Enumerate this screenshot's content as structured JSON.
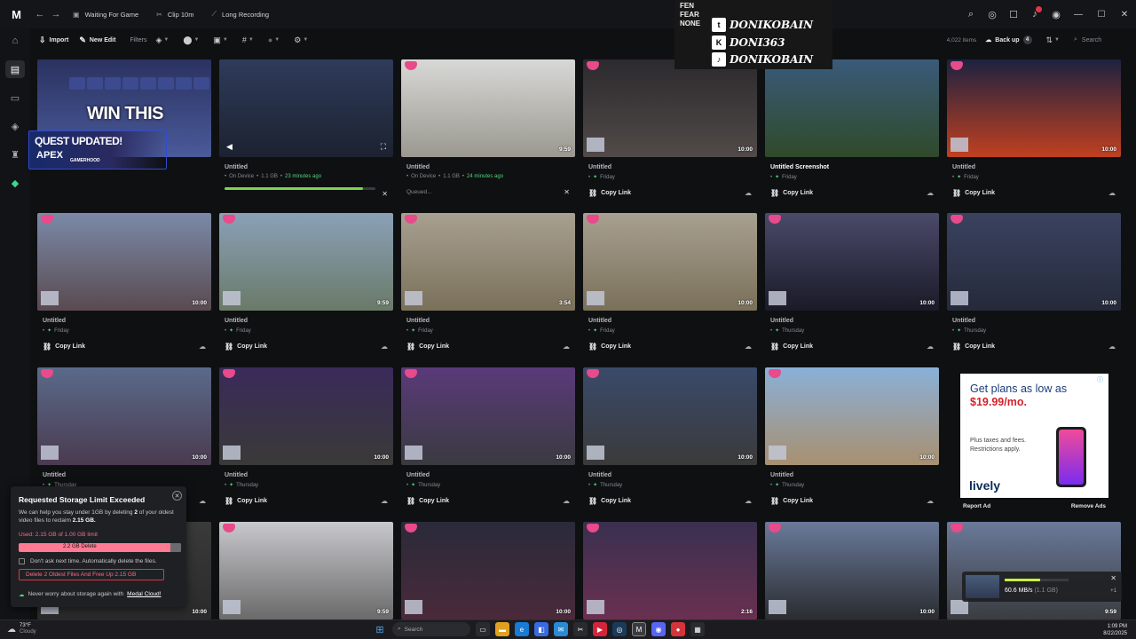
{
  "window": {
    "logo": "M",
    "tabs": [
      {
        "label": "Waiting For Game",
        "icon": "gamepad-icon"
      },
      {
        "label": "Clip 10m",
        "icon": "scissors-icon"
      },
      {
        "label": "Long Recording",
        "icon": "slash-icon"
      }
    ]
  },
  "toolbar": {
    "import_label": "Import",
    "new_edit_label": "New Edit",
    "filters_label": "Filters",
    "items_count": "4,022 items",
    "backup_label": "Back up",
    "backup_count": "4",
    "search_placeholder": "Search"
  },
  "promo": {
    "headline": "WIN THIS",
    "quest_title": "QUEST UPDATED!",
    "quest_game": "APEX",
    "quest_sponsor": "GAMERHOOD"
  },
  "socials": {
    "tag": "FEN FEAR NONE",
    "rows": [
      {
        "network": "twitch",
        "glyph": "t",
        "name": "DONIKOBAIN"
      },
      {
        "network": "kick",
        "glyph": "K",
        "name": "DONI363"
      },
      {
        "network": "tiktok",
        "glyph": "♪",
        "name": "DONIKOBAIN"
      }
    ]
  },
  "cards": [
    {
      "title": "",
      "kind": "promo"
    },
    {
      "title": "Untitled",
      "meta_a": "On Device",
      "meta_b": "1.1 GB",
      "meta_c": "23 minutes ago",
      "progress": 0.92,
      "kind": "uploading"
    },
    {
      "title": "Untitled",
      "meta_a": "On Device",
      "meta_b": "1.1 GB",
      "meta_c": "24 minutes ago",
      "duration": "9:59",
      "status": "Queued...",
      "kind": "queued"
    },
    {
      "title": "Untitled",
      "day": "Friday",
      "duration": "10:00",
      "action": "Copy Link"
    },
    {
      "title": "Untitled Screenshot",
      "day": "Friday",
      "action": "Copy Link",
      "white": true
    },
    {
      "title": "Untitled",
      "day": "Friday",
      "duration": "10:00",
      "action": "Copy Link"
    },
    {
      "title": "Untitled",
      "day": "Friday",
      "duration": "10:00",
      "action": "Copy Link"
    },
    {
      "title": "Untitled",
      "day": "Friday",
      "duration": "9:59",
      "action": "Copy Link"
    },
    {
      "title": "Untitled",
      "day": "Friday",
      "duration": "3:54",
      "action": "Copy Link"
    },
    {
      "title": "Untitled",
      "day": "Friday",
      "duration": "10:00",
      "action": "Copy Link"
    },
    {
      "title": "Untitled",
      "day": "Thursday",
      "duration": "10:00",
      "action": "Copy Link"
    },
    {
      "title": "Untitled",
      "day": "Thursday",
      "duration": "10:00",
      "action": "Copy Link"
    },
    {
      "title": "Untitled",
      "day": "Thursday",
      "duration": "10:00",
      "action": "Copy Link"
    },
    {
      "title": "Untitled",
      "day": "Thursday",
      "duration": "10:00",
      "action": "Copy Link"
    },
    {
      "title": "Untitled",
      "day": "Thursday",
      "duration": "10:00",
      "action": "Copy Link"
    },
    {
      "title": "Untitled",
      "day": "Thursday",
      "duration": "10:00",
      "action": "Copy Link"
    },
    {
      "title": "Untitled",
      "day": "Thursday",
      "duration": "10:00",
      "action": "Copy Link"
    },
    {
      "kind": "ad"
    },
    {
      "duration": "10:00"
    },
    {
      "duration": "9:59"
    },
    {
      "duration": "10:00"
    },
    {
      "duration": "2:16"
    },
    {
      "duration": "10:00"
    },
    {
      "duration": "9:59"
    }
  ],
  "thumb_colors": [
    [
      "#2b3550",
      "#22293d"
    ],
    [
      "#2e3b5a",
      "#1c2230"
    ],
    [
      "#d8d8d6",
      "#9a9890"
    ],
    [
      "#2c2a2e",
      "#514a48"
    ],
    [
      "#3a5a7a",
      "#2f4a2a"
    ],
    [
      "#1c2240",
      "#c04020"
    ],
    [
      "#7a8aa8",
      "#5a4a50"
    ],
    [
      "#8aa0b8",
      "#6a7a68"
    ],
    [
      "#a8a090",
      "#7a705a"
    ],
    [
      "#a8a090",
      "#7a705a"
    ],
    [
      "#4a4a6a",
      "#1a1a28"
    ],
    [
      "#3a4260",
      "#252a3a"
    ],
    [
      "#5a6a8a",
      "#4a3a50"
    ],
    [
      "#3a2a5a",
      "#3a3a38"
    ],
    [
      "#5a3a7a",
      "#3a3a40"
    ],
    [
      "#3a4a6a",
      "#3a3a3a"
    ],
    [
      "#8ab0d8",
      "#a89070"
    ],
    [
      "#ffffff",
      "#ffffff"
    ],
    [
      "#3a3a3a",
      "#2a2a2a"
    ],
    [
      "#c8c8cc",
      "#6a6a6a"
    ],
    [
      "#2a2a3a",
      "#4a2a3a"
    ],
    [
      "#3a3050",
      "#6a3050"
    ],
    [
      "#6a7a9a",
      "#2a2c30"
    ],
    [
      "#6a7a9a",
      "#3a3c40"
    ]
  ],
  "ad": {
    "headline_a": "Get plans as low as",
    "price": "$19.99/mo.",
    "fine_print_1": "Plus taxes and fees.",
    "fine_print_2": "Restrictions apply.",
    "brand": "lively",
    "report_label": "Report Ad",
    "remove_label": "Remove Ads"
  },
  "storage_popup": {
    "title": "Requested Storage Limit Exceeded",
    "desc_1": "We can help you stay under 1GB by deleting",
    "desc_count": "2",
    "desc_2": "of your oldest video files to reclaim",
    "desc_size": "2.15 GB.",
    "used_text": "Used: 2.15 GB of 1.00 GB limit",
    "bar_label": "2.2 GB Delete",
    "checkbox_label": "Don't ask next time. Automatically delete the files.",
    "delete_button": "Delete 2 Oldest Files And Free Up 2.15 GB",
    "cloud_prefix": "Never worry about storage again with",
    "cloud_link": "Medal Cloud!"
  },
  "upload_toast": {
    "speed": "60.6 MB/s",
    "size": "(1.1 GB)",
    "more": "+1",
    "progress": 0.56
  },
  "taskbar": {
    "temp": "73°F",
    "condition": "Cloudy",
    "search_label": "Search",
    "time": "1:09 PM",
    "date": "8/22/2025"
  }
}
